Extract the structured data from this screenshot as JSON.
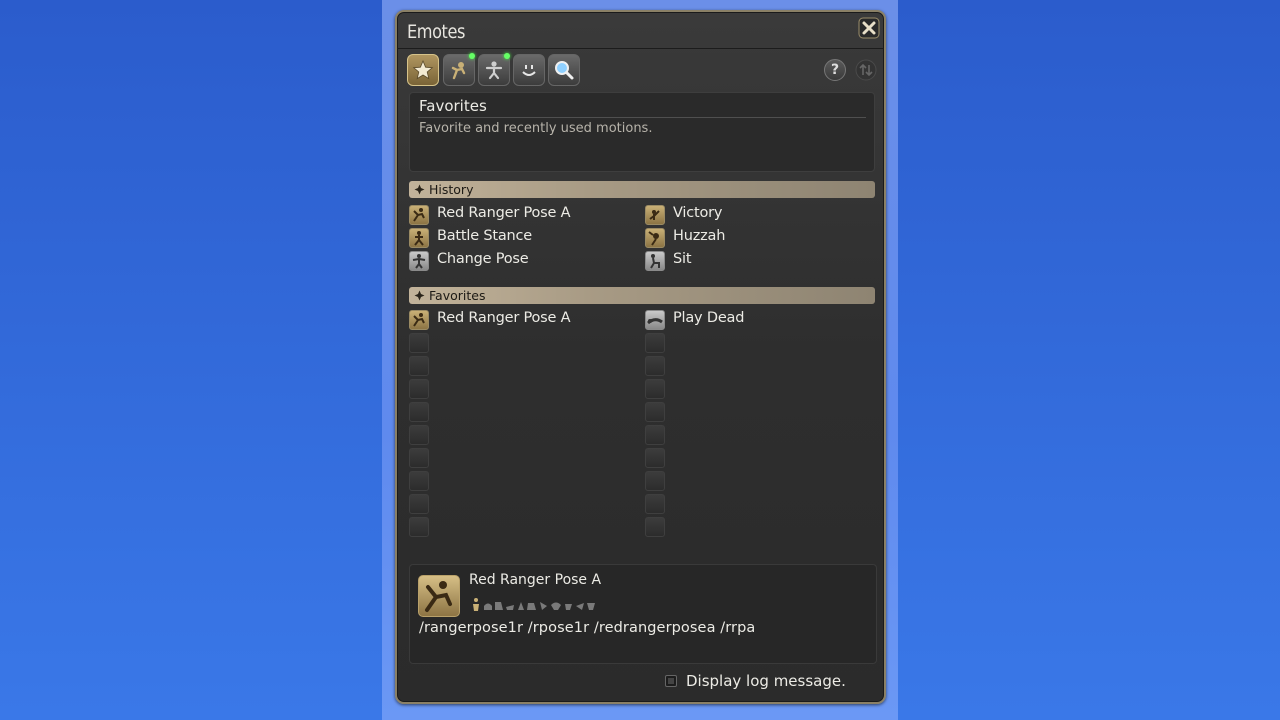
{
  "window": {
    "title": "Emotes"
  },
  "toolbar": {
    "tabs": [
      {
        "icon": "star-icon",
        "active": true,
        "new": false
      },
      {
        "icon": "general-emote-icon",
        "active": false,
        "new": true
      },
      {
        "icon": "special-emote-icon",
        "active": false,
        "new": true
      },
      {
        "icon": "expression-icon",
        "active": false,
        "new": false
      },
      {
        "icon": "search-icon",
        "active": false,
        "new": false
      }
    ],
    "help_label": "?"
  },
  "description": {
    "title": "Favorites",
    "text": "Favorite and recently used motions."
  },
  "history": {
    "label": "History",
    "left": [
      "Red Ranger Pose A",
      "Battle Stance",
      "Change Pose"
    ],
    "right": [
      "Victory",
      "Huzzah",
      "Sit"
    ]
  },
  "favorites": {
    "label": "Favorites",
    "left": [
      "Red Ranger Pose A"
    ],
    "right": [
      "Play Dead"
    ]
  },
  "detail": {
    "title": "Red Ranger Pose A",
    "commands": "/rangerpose1r /rpose1r /redrangerposea /rrpa"
  },
  "log_option": {
    "label": "Display log message.",
    "checked": false
  },
  "colors": {
    "accent": "#c9b076",
    "text": "#ecebe5",
    "panel": "#2e2e2e"
  }
}
